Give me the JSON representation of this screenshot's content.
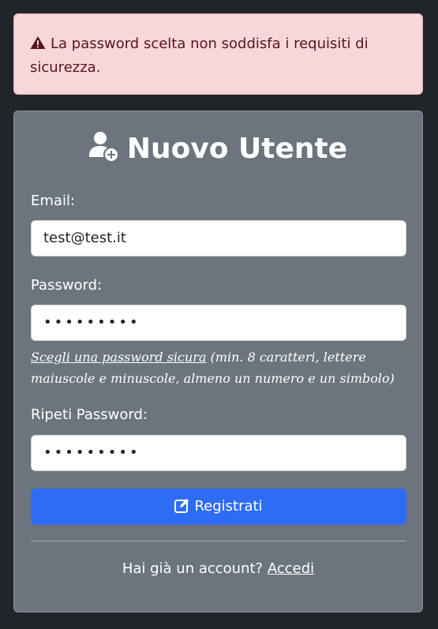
{
  "alert": {
    "text": "La password scelta non soddisfa i requisiti di sicurezza.",
    "icon": "warning-icon",
    "color": "#58151c",
    "background": "#f8d7da"
  },
  "card": {
    "title": "Nuovo Utente",
    "title_icon": "user-plus-icon"
  },
  "form": {
    "email_label": "Email:",
    "email_value": "test@test.it",
    "password_label": "Password:",
    "password_value": "•••••••••",
    "hint_link": "Scegli una password sicura",
    "hint_text": " (min. 8 caratteri, lettere maiuscole e minuscole, almeno un numero e un simbolo)",
    "repeat_label": "Ripeti Password:",
    "repeat_value": "•••••••••",
    "submit_label": "Registrati",
    "submit_icon": "edit-icon",
    "submit_color": "#2f6cf6"
  },
  "footer": {
    "text": "Hai già un account?",
    "link": "Accedi"
  }
}
